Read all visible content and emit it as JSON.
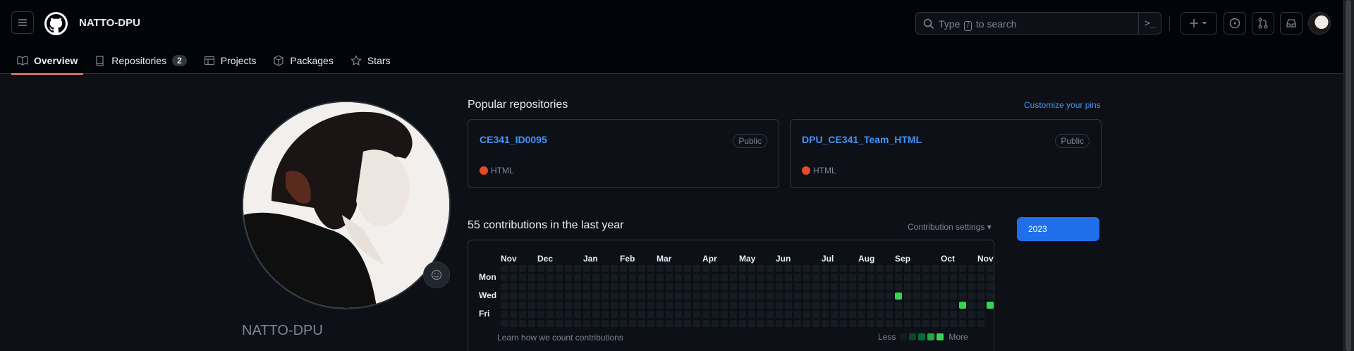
{
  "header": {
    "username": "NATTO-DPU",
    "search_placeholder_pre": "Type",
    "search_key": "/",
    "search_placeholder_post": "to search",
    "command_palette": ">_",
    "create_label": "+"
  },
  "tabs": [
    {
      "label": "Overview",
      "icon": "book-icon",
      "active": true
    },
    {
      "label": "Repositories",
      "icon": "repo-icon",
      "count": "2"
    },
    {
      "label": "Projects",
      "icon": "table-icon"
    },
    {
      "label": "Packages",
      "icon": "package-icon"
    },
    {
      "label": "Stars",
      "icon": "star-icon"
    }
  ],
  "profile": {
    "name": "NATTO-DPU"
  },
  "popular": {
    "title": "Popular repositories",
    "customize_link": "Customize your pins",
    "repos": [
      {
        "name": "CE341_ID0095",
        "visibility": "Public",
        "language": "HTML",
        "language_color": "#e34c26"
      },
      {
        "name": "DPU_CE341_Team_HTML",
        "visibility": "Public",
        "language": "HTML",
        "language_color": "#e34c26"
      }
    ]
  },
  "contributions": {
    "title": "55 contributions in the last year",
    "settings_label": "Contribution settings ▾",
    "year": "2023",
    "months": [
      "Nov",
      "Dec",
      "Jan",
      "Feb",
      "Mar",
      "Apr",
      "May",
      "Jun",
      "Jul",
      "Aug",
      "Sep",
      "Oct",
      "Nov"
    ],
    "days": [
      "Mon",
      "Wed",
      "Fri"
    ],
    "learn_link": "Learn how we count contributions",
    "legend_less": "Less",
    "legend_more": "More",
    "level_colors": [
      "#161b22",
      "#0e4429",
      "#006d32",
      "#26a641",
      "#39d353"
    ],
    "active_cells": [
      {
        "week": 43,
        "day": 3,
        "level": 4
      },
      {
        "week": 50,
        "day": 4,
        "level": 4
      },
      {
        "week": 53,
        "day": 4,
        "level": 4
      }
    ]
  }
}
